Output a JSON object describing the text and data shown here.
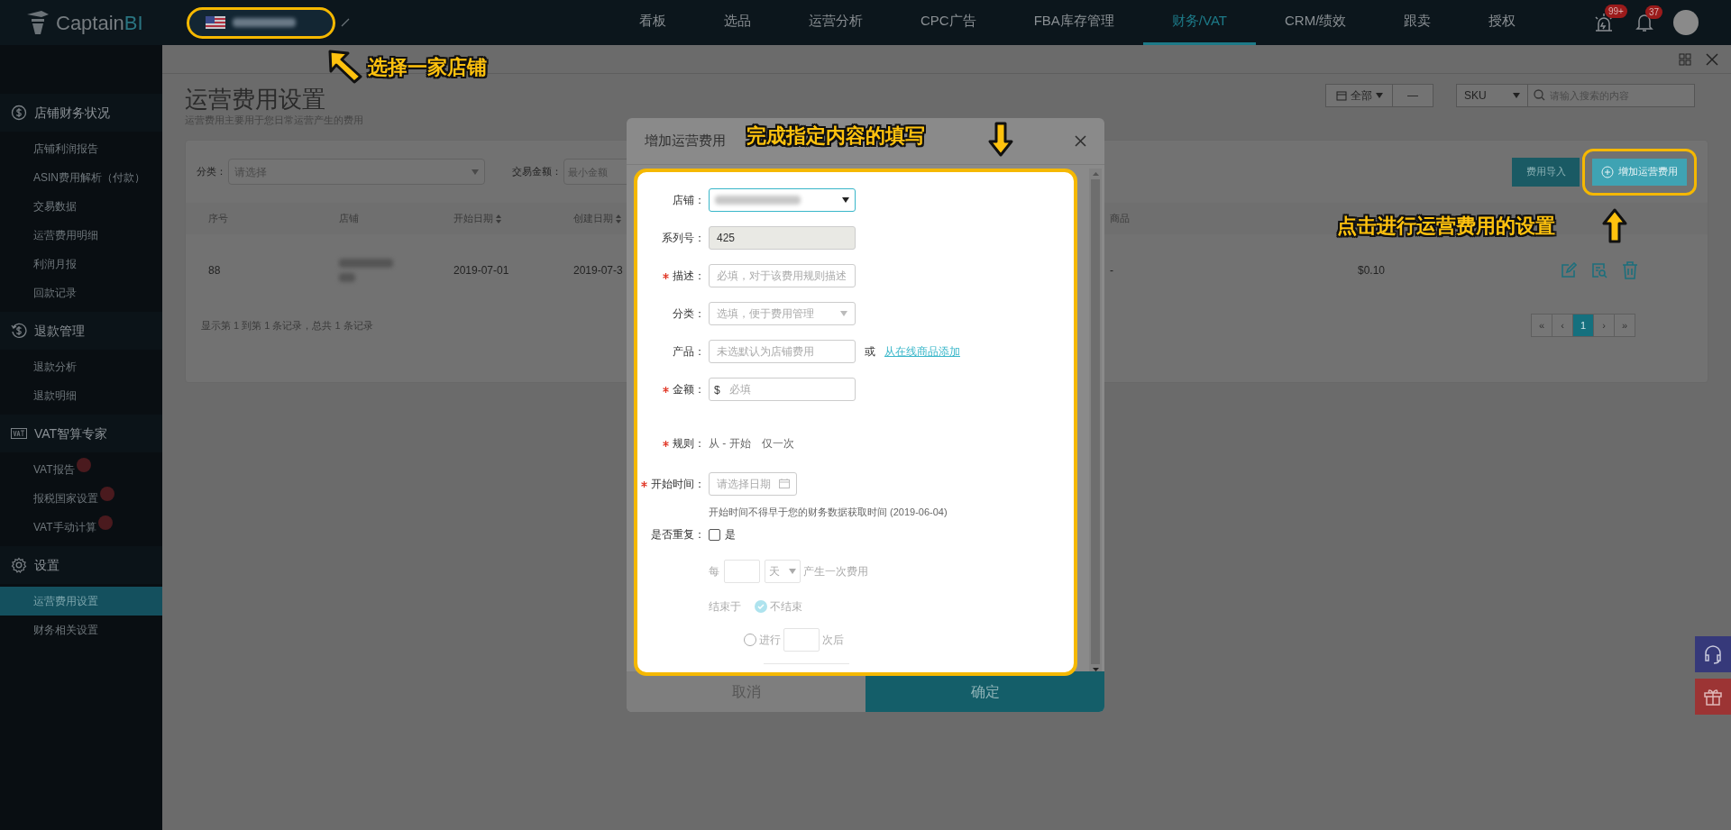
{
  "topbar": {
    "logo": {
      "name": "Captain",
      "suffix": "BI"
    },
    "nav": [
      {
        "label": "看板",
        "selected": false
      },
      {
        "label": "选品",
        "selected": false
      },
      {
        "label": "运营分析",
        "selected": false
      },
      {
        "label": "CPC广告",
        "selected": false
      },
      {
        "label": "FBA库存管理",
        "selected": false
      },
      {
        "label": "财务/VAT",
        "selected": true
      },
      {
        "label": "CRM/绩效",
        "selected": false
      },
      {
        "label": "跟卖",
        "selected": false
      },
      {
        "label": "授权",
        "selected": false
      }
    ],
    "alerts_badge": "99+",
    "notifications_badge": "37"
  },
  "sidebar": {
    "sections": [
      {
        "title": "店铺财务状况",
        "items": [
          {
            "label": "店铺利润报告",
            "selected": false,
            "dot": false
          },
          {
            "label": "ASIN费用解析（付款）",
            "selected": false,
            "dot": false
          },
          {
            "label": "交易数据",
            "selected": false,
            "dot": false
          },
          {
            "label": "运营费用明细",
            "selected": false,
            "dot": false
          },
          {
            "label": "利润月报",
            "selected": false,
            "dot": false
          },
          {
            "label": "回款记录",
            "selected": false,
            "dot": false
          }
        ]
      },
      {
        "title": "退款管理",
        "items": [
          {
            "label": "退款分析",
            "selected": false,
            "dot": false
          },
          {
            "label": "退款明细",
            "selected": false,
            "dot": false
          }
        ]
      },
      {
        "title": "VAT智算专家",
        "items": [
          {
            "label": "VAT报告",
            "selected": false,
            "dot": true
          },
          {
            "label": "报税国家设置",
            "selected": false,
            "dot": true
          },
          {
            "label": "VAT手动计算",
            "selected": false,
            "dot": true
          }
        ]
      },
      {
        "title": "设置",
        "items": [
          {
            "label": "运营费用设置",
            "selected": true,
            "dot": false
          },
          {
            "label": "财务相关设置",
            "selected": false,
            "dot": false
          }
        ]
      }
    ]
  },
  "page": {
    "title": "运营费用设置",
    "subtitle": "运营费用主要用于您日常运营产生的费用",
    "date_filter": "全部",
    "date_range": "—",
    "search_type": "SKU",
    "search_placeholder": "请输入搜索的内容"
  },
  "filters": {
    "category_label": "分类：",
    "category_placeholder": "请选择",
    "amount_label": "交易金额：",
    "amount_placeholder": "最小金额"
  },
  "buttons": {
    "import": "费用导入",
    "add": "增加运营费用"
  },
  "table": {
    "columns": [
      {
        "label": "序号",
        "sortable": false
      },
      {
        "label": "店铺",
        "sortable": false
      },
      {
        "label": "开始日期",
        "sortable": true
      },
      {
        "label": "创建日期",
        "sortable": true
      },
      {
        "label": "商品",
        "sortable": false
      }
    ],
    "rows": [
      {
        "id": "88",
        "start": "2019-07-01",
        "created": "2019-07-3",
        "product": "-",
        "amount": "$0.10"
      }
    ]
  },
  "footer_text": "显示第 1 到第 1 条记录，总共 1 条记录",
  "pagination": [
    {
      "label": "«",
      "selected": false
    },
    {
      "label": "‹",
      "selected": false
    },
    {
      "label": "1",
      "selected": true
    },
    {
      "label": "›",
      "selected": false
    },
    {
      "label": "»",
      "selected": false
    }
  ],
  "modal": {
    "title": "增加运营费用",
    "fields": [
      {
        "kind": "select",
        "label": "店铺：",
        "required": false
      },
      {
        "kind": "readonly",
        "label": "系列号：",
        "required": false,
        "value": "425"
      },
      {
        "kind": "text",
        "label": "描述：",
        "required": true,
        "placeholder": "必填，对于该费用规则描述"
      },
      {
        "kind": "dropdown",
        "label": "分类：",
        "required": false,
        "placeholder": "选填，便于费用管理"
      },
      {
        "kind": "product",
        "label": "产品：",
        "required": false,
        "placeholder": "未选默认为店铺费用",
        "or": "或",
        "link": "从在线商品添加"
      },
      {
        "kind": "money",
        "label": "金额：",
        "required": true,
        "prefix": "$",
        "placeholder": "必填"
      },
      {
        "kind": "rule",
        "label": "规则：",
        "required": true,
        "text": "从 - 开始",
        "extra": "仅一次"
      },
      {
        "kind": "date",
        "label": "开始时间：",
        "required": true,
        "placeholder": "请选择日期",
        "hint": "开始时间不得早于您的财务数据获取时间 (2019-06-04)"
      },
      {
        "kind": "checkbox",
        "label": "是否重复：",
        "required": false,
        "checked": false,
        "option": "是"
      }
    ],
    "repeat": {
      "every": "每",
      "unit": "天",
      "suffix": "产生一次费用",
      "end_label": "结束于",
      "end_options": [
        {
          "label": "不结束",
          "selected": true
        },
        {
          "label": "进行",
          "suffix": "次后",
          "selected": false
        }
      ]
    },
    "cancel": "取消",
    "confirm": "确定"
  },
  "annotations": [
    {
      "kind": "store",
      "text": "选择一家店铺"
    },
    {
      "kind": "form",
      "text": "完成指定内容的填写"
    },
    {
      "kind": "button",
      "text": "点击进行运营费用的设置"
    }
  ]
}
